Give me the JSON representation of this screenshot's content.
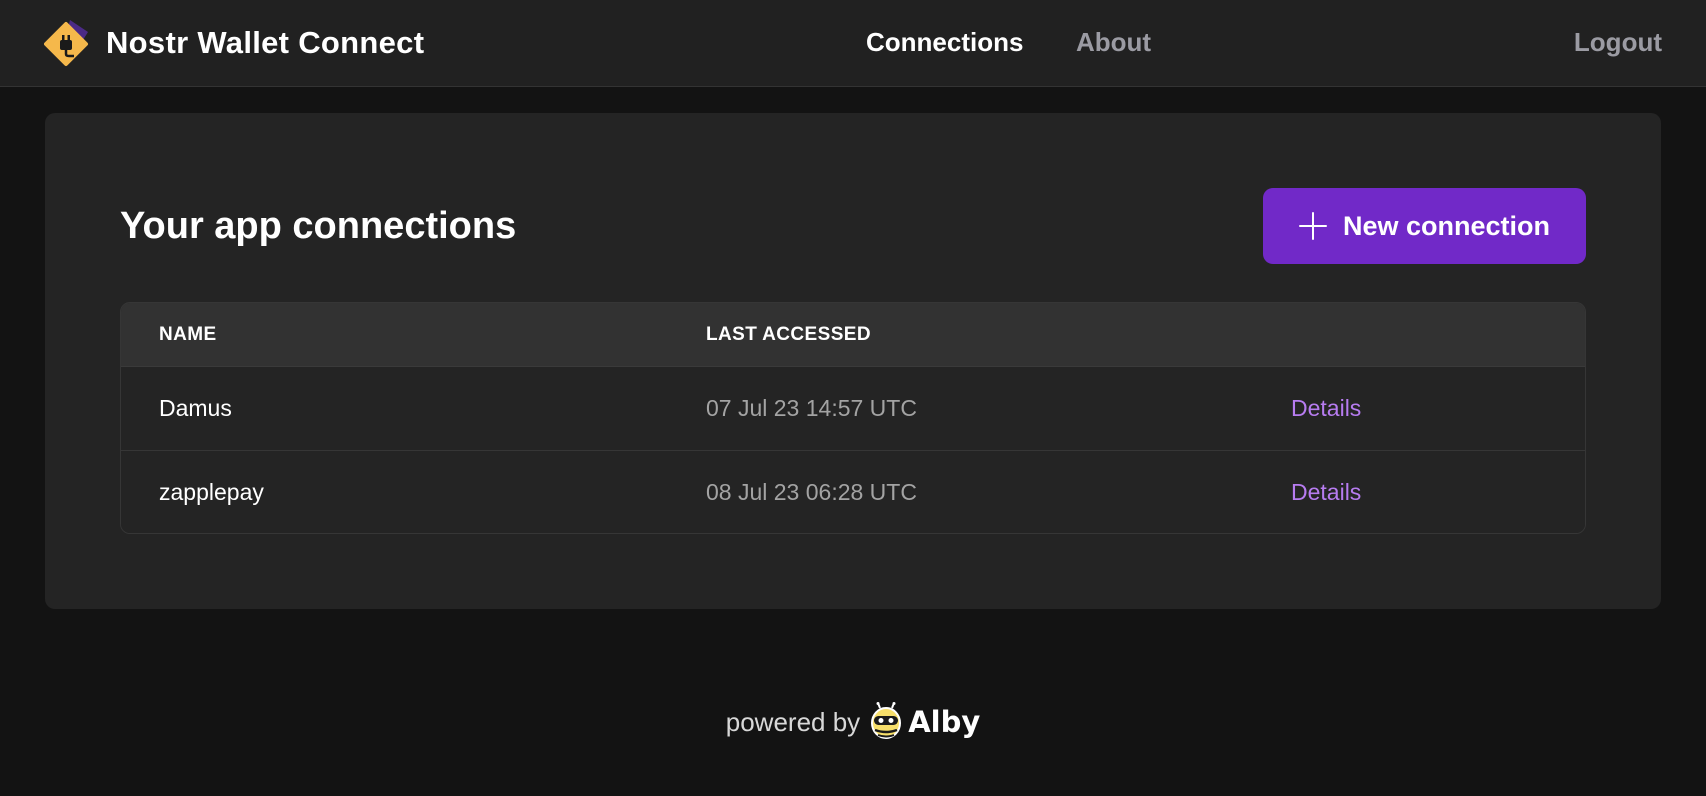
{
  "header": {
    "app_name": "Nostr Wallet Connect",
    "nav": {
      "connections": "Connections",
      "about": "About",
      "logout": "Logout"
    }
  },
  "main": {
    "title": "Your app connections",
    "new_connection_label": "New connection",
    "table": {
      "columns": [
        "NAME",
        "LAST ACCESSED"
      ],
      "rows": [
        {
          "name": "Damus",
          "last_accessed": "07 Jul 23 14:57 UTC",
          "action": "Details"
        },
        {
          "name": "zapplepay",
          "last_accessed": "08 Jul 23 06:28 UTC",
          "action": "Details"
        }
      ]
    }
  },
  "footer": {
    "powered_by": "powered by",
    "brand": "Alby"
  },
  "colors": {
    "accent": "#7129c8",
    "link": "#b77cf0",
    "background": "#131313",
    "header": "#212121",
    "card": "#242424",
    "logo_yellow": "#f5b84b",
    "logo_purple": "#4b2a86"
  },
  "icons": {
    "logo": "wallet-plug-icon",
    "add": "plus-icon",
    "footer": "alby-bee-icon"
  }
}
